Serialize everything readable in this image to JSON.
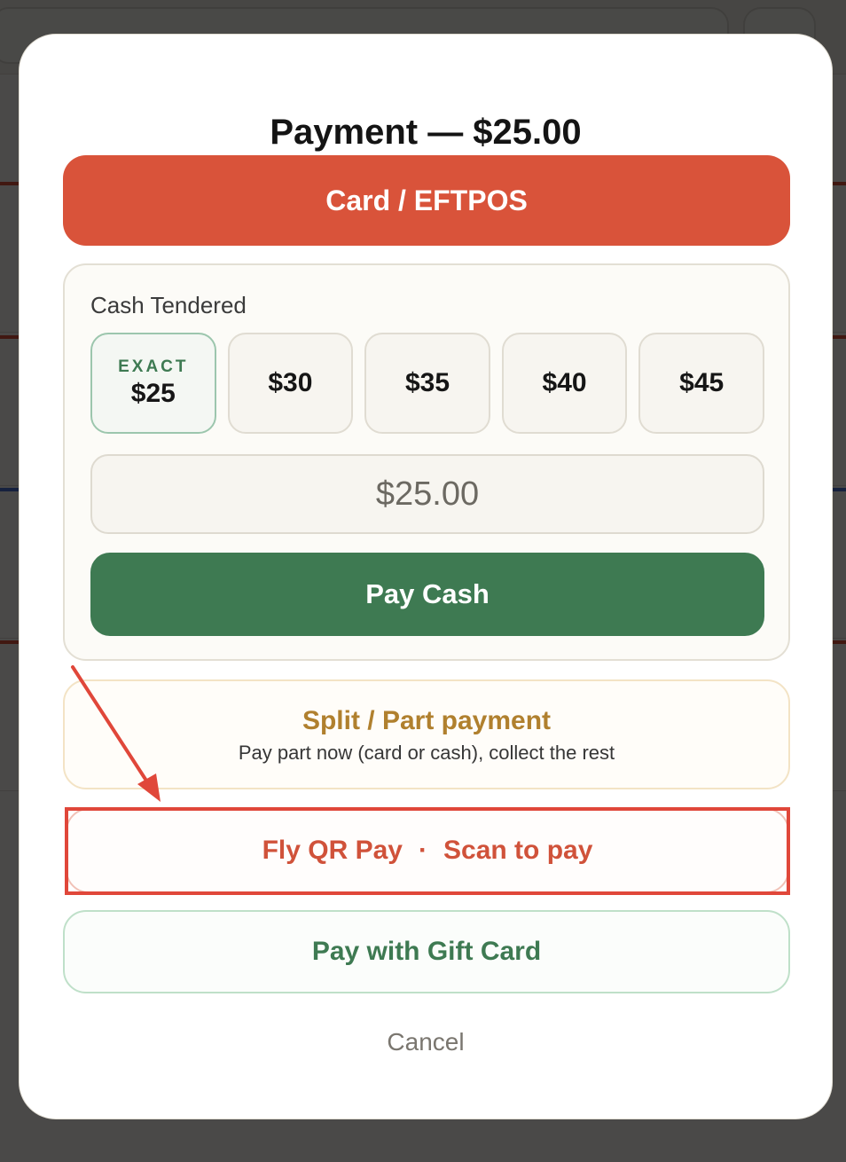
{
  "modal": {
    "title": "Payment — $25.00",
    "card_button": "Card / EFTPOS",
    "cash": {
      "label": "Cash Tendered",
      "exact_tag": "EXACT",
      "amounts": [
        "$25",
        "$30",
        "$35",
        "$40",
        "$45"
      ],
      "input_value": "$25.00",
      "pay_button": "Pay Cash"
    },
    "split": {
      "title": "Split / Part payment",
      "subtitle": "Pay part now (card or cash), collect the rest"
    },
    "flyqr": {
      "label": "Fly QR Pay",
      "separator": "·",
      "action": "Scan to pay"
    },
    "gift_button": "Pay with Gift Card",
    "cancel": "Cancel"
  },
  "colors": {
    "card": "#d9533a",
    "cash_green": "#3e7a52",
    "split_gold": "#b0802e",
    "flyqr_red": "#d0523a",
    "annotation_red": "#e0473a"
  },
  "icons": [
    "arrow-annotation-icon"
  ]
}
